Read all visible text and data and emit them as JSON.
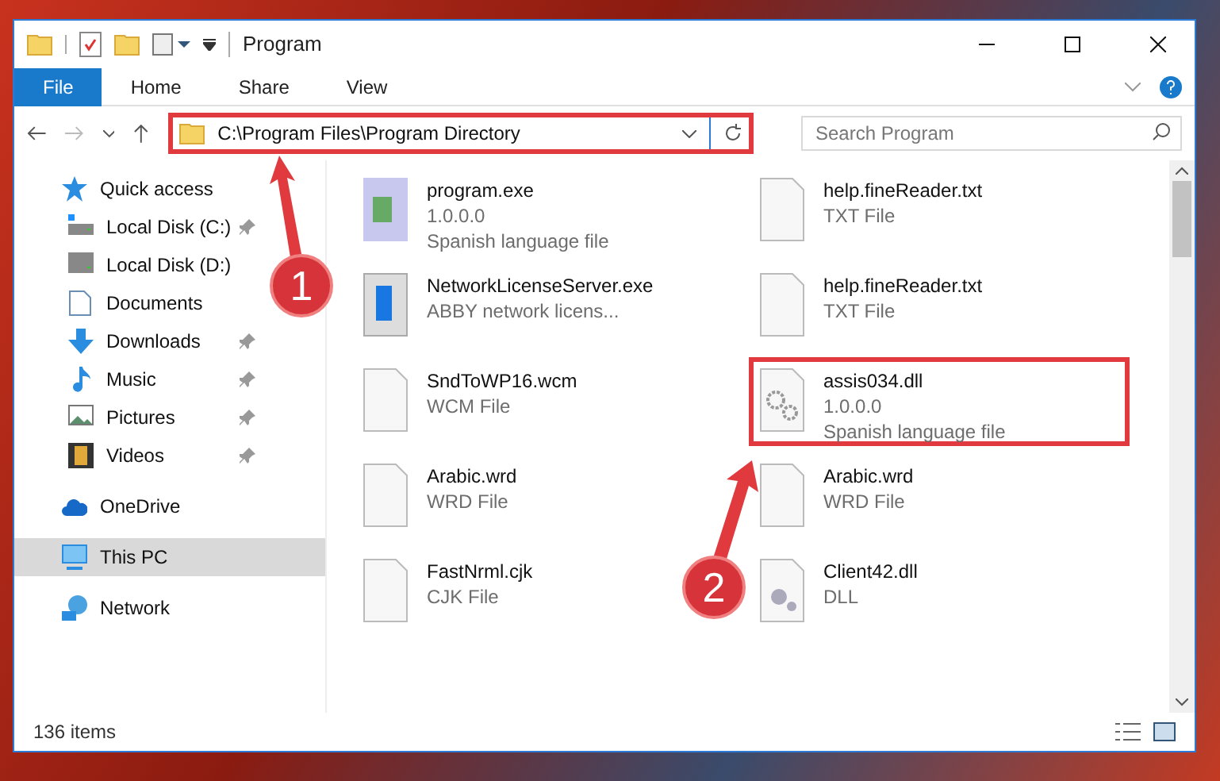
{
  "window": {
    "title": "Program"
  },
  "ribbon_tabs": [
    {
      "label": "File",
      "selected": true
    },
    {
      "label": "Home",
      "selected": false
    },
    {
      "label": "Share",
      "selected": false
    },
    {
      "label": "View",
      "selected": false
    }
  ],
  "address_bar": {
    "value": "C:\\Program Files\\Program Directory",
    "highlighted": true
  },
  "search": {
    "placeholder": "Search Program"
  },
  "sidebar": {
    "items": [
      {
        "label": "Quick access",
        "selected": false,
        "children": [
          {
            "label": "Local Disk (C:)",
            "pinned": true,
            "selected": false
          },
          {
            "label": "Local Disk (D:)",
            "pinned": false,
            "selected": false
          },
          {
            "label": "Documents",
            "pinned": false,
            "selected": false
          },
          {
            "label": "Downloads",
            "pinned": true,
            "selected": false
          },
          {
            "label": "Music",
            "pinned": true,
            "selected": false
          },
          {
            "label": "Pictures",
            "pinned": true,
            "selected": false
          },
          {
            "label": "Videos",
            "pinned": true,
            "selected": false
          }
        ]
      },
      {
        "label": "OneDrive",
        "selected": false
      },
      {
        "label": "This PC",
        "selected": true
      },
      {
        "label": "Network",
        "selected": false
      }
    ]
  },
  "files": [
    {
      "name": "program.exe",
      "details": [
        "1.0.0.0",
        "Spanish language file"
      ],
      "kind": "exe",
      "highlighted": false
    },
    {
      "name": "help.fineReader.txt",
      "details": [
        "TXT File"
      ],
      "kind": "doc",
      "highlighted": false
    },
    {
      "name": "NetworkLicenseServer.exe",
      "details": [
        "ABBY network licens..."
      ],
      "kind": "window",
      "highlighted": false
    },
    {
      "name": "help.fineReader.txt",
      "details": [
        "TXT File"
      ],
      "kind": "doc",
      "highlighted": false
    },
    {
      "name": "SndToWP16.wcm",
      "details": [
        "WCM File"
      ],
      "kind": "doc",
      "highlighted": false
    },
    {
      "name": "assis034.dll",
      "details": [
        "1.0.0.0",
        "Spanish language file"
      ],
      "kind": "gears",
      "highlighted": true
    },
    {
      "name": "Arabic.wrd",
      "details": [
        "WRD File"
      ],
      "kind": "doc",
      "highlighted": false
    },
    {
      "name": "Arabic.wrd",
      "details": [
        "WRD File"
      ],
      "kind": "doc",
      "highlighted": false
    },
    {
      "name": "FastNrml.cjk",
      "details": [
        "CJK File"
      ],
      "kind": "doc",
      "highlighted": false
    },
    {
      "name": "Client42.dll",
      "details": [
        "DLL"
      ],
      "kind": "gear",
      "highlighted": false
    }
  ],
  "status_bar": {
    "item_count": "136 items"
  },
  "annotations": [
    {
      "label": "1"
    },
    {
      "label": "2"
    }
  ]
}
